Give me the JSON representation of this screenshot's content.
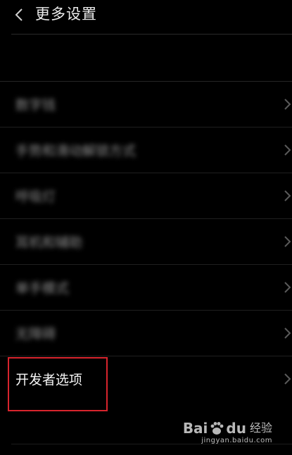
{
  "header": {
    "back_icon": "chevron-left-icon",
    "title": "更多设置"
  },
  "settings": {
    "items": [
      {
        "label": "数字钱",
        "blurred": true
      },
      {
        "label": "手势和滑动解锁方式",
        "blurred": true
      },
      {
        "label": "呼吸灯",
        "blurred": true
      },
      {
        "label": "耳机和辅助",
        "blurred": true
      },
      {
        "label": "单手模式",
        "blurred": true
      },
      {
        "label": "无障碍",
        "blurred": true
      },
      {
        "label": "开发者选项",
        "blurred": false
      }
    ],
    "chevron_icon": "chevron-right-icon"
  },
  "highlight": {
    "target": "开发者选项",
    "color": "#d8242d"
  },
  "watermark": {
    "brand": "Bai",
    "brand_suffix": "du",
    "subtitle": "经验",
    "url": "jingyan.baidu.com"
  },
  "colors": {
    "background": "#000000",
    "text": "#f5f5f5",
    "divider": "#1f1f1f"
  }
}
